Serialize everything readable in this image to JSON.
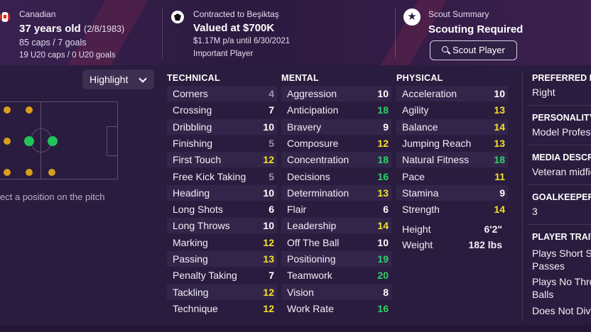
{
  "header": {
    "nationality": "Canadian",
    "age_line": "37 years old",
    "dob": "(2/8/1983)",
    "caps": "85 caps / 7 goals",
    "u20": "19 U20 caps / 0 U20 goals",
    "contract_label": "Contracted to Beşiktaş",
    "value": "Valued at $700K",
    "wage": "$1.17M p/a until 6/30/2021",
    "importance": "Important Player",
    "scout_label": "Scout Summary",
    "scout_status": "Scouting Required",
    "scout_button": "Scout Player"
  },
  "pitch": {
    "highlight_label": "Highlight",
    "select_hint": "ect a position on the pitch"
  },
  "technical": {
    "title": "TECHNICAL",
    "items": [
      {
        "name": "Corners",
        "value": "4"
      },
      {
        "name": "Crossing",
        "value": "7"
      },
      {
        "name": "Dribbling",
        "value": "10"
      },
      {
        "name": "Finishing",
        "value": "5"
      },
      {
        "name": "First Touch",
        "value": "12"
      },
      {
        "name": "Free Kick Taking",
        "value": "5"
      },
      {
        "name": "Heading",
        "value": "10"
      },
      {
        "name": "Long Shots",
        "value": "6"
      },
      {
        "name": "Long Throws",
        "value": "10"
      },
      {
        "name": "Marking",
        "value": "12"
      },
      {
        "name": "Passing",
        "value": "13"
      },
      {
        "name": "Penalty Taking",
        "value": "7"
      },
      {
        "name": "Tackling",
        "value": "12"
      },
      {
        "name": "Technique",
        "value": "12"
      }
    ]
  },
  "mental": {
    "title": "MENTAL",
    "items": [
      {
        "name": "Aggression",
        "value": "10"
      },
      {
        "name": "Anticipation",
        "value": "18"
      },
      {
        "name": "Bravery",
        "value": "9"
      },
      {
        "name": "Composure",
        "value": "12"
      },
      {
        "name": "Concentration",
        "value": "18"
      },
      {
        "name": "Decisions",
        "value": "16"
      },
      {
        "name": "Determination",
        "value": "13"
      },
      {
        "name": "Flair",
        "value": "6"
      },
      {
        "name": "Leadership",
        "value": "14"
      },
      {
        "name": "Off The Ball",
        "value": "10"
      },
      {
        "name": "Positioning",
        "value": "19"
      },
      {
        "name": "Teamwork",
        "value": "20"
      },
      {
        "name": "Vision",
        "value": "8"
      },
      {
        "name": "Work Rate",
        "value": "16"
      }
    ]
  },
  "physical": {
    "title": "PHYSICAL",
    "items": [
      {
        "name": "Acceleration",
        "value": "10"
      },
      {
        "name": "Agility",
        "value": "13"
      },
      {
        "name": "Balance",
        "value": "14"
      },
      {
        "name": "Jumping Reach",
        "value": "13"
      },
      {
        "name": "Natural Fitness",
        "value": "18"
      },
      {
        "name": "Pace",
        "value": "11"
      },
      {
        "name": "Stamina",
        "value": "9"
      },
      {
        "name": "Strength",
        "value": "14"
      }
    ],
    "height_label": "Height",
    "height_value": "6'2\"",
    "weight_label": "Weight",
    "weight_value": "182 lbs"
  },
  "right_panel": {
    "preferred_foot_head": "PREFERRED F",
    "preferred_foot": "Right",
    "personality_head": "PERSONALITY",
    "personality": "Model Profess",
    "media_head": "MEDIA DESCR",
    "media": "Veteran midfie",
    "goalkeeper_head": "GOALKEEPER",
    "goalkeeper": "3",
    "traits_head": "PLAYER TRAIT",
    "trait1a": "Plays Short Si",
    "trait1b": "Passes",
    "trait2a": "Plays No Thro",
    "trait2b": "Balls",
    "trait3": "Does Not Dive"
  },
  "colors": {
    "background": "#2a1c3e",
    "low": "#9a90aa",
    "mid": "#ffffff",
    "good": "#f2e32a",
    "great": "#2ad46a",
    "accent_dot": "#d99e1c"
  }
}
